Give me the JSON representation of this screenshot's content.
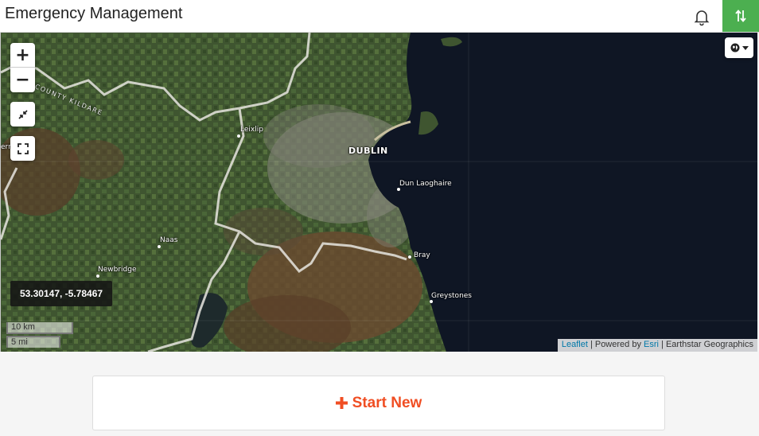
{
  "header": {
    "title": "Emergency Management",
    "icons": [
      "bell-icon",
      "sort-icon"
    ],
    "accent_color": "#4caf50"
  },
  "map": {
    "zoom_in": "+",
    "zoom_out": "−",
    "coordinates": "53.30147, -5.78467",
    "scale_km": "10 km",
    "scale_mi": "5 mi",
    "attribution": {
      "leaflet": "Leaflet",
      "powered_by": "| Powered by",
      "esri": "Esri",
      "source": "| Earthstar Geographics"
    },
    "places": {
      "dublin": "DUBLIN",
      "leixlip": "Leixlip",
      "dun_laoghaire": "Dun Laoghaire",
      "naas": "Naas",
      "newbridge": "Newbridge",
      "bray": "Bray",
      "greystones": "Greystones",
      "county_kildare": "COUNTY KILDARE",
      "edge_label": "err"
    }
  },
  "actions": {
    "start_new_label": "Start New",
    "start_new_color": "#f04e23"
  }
}
